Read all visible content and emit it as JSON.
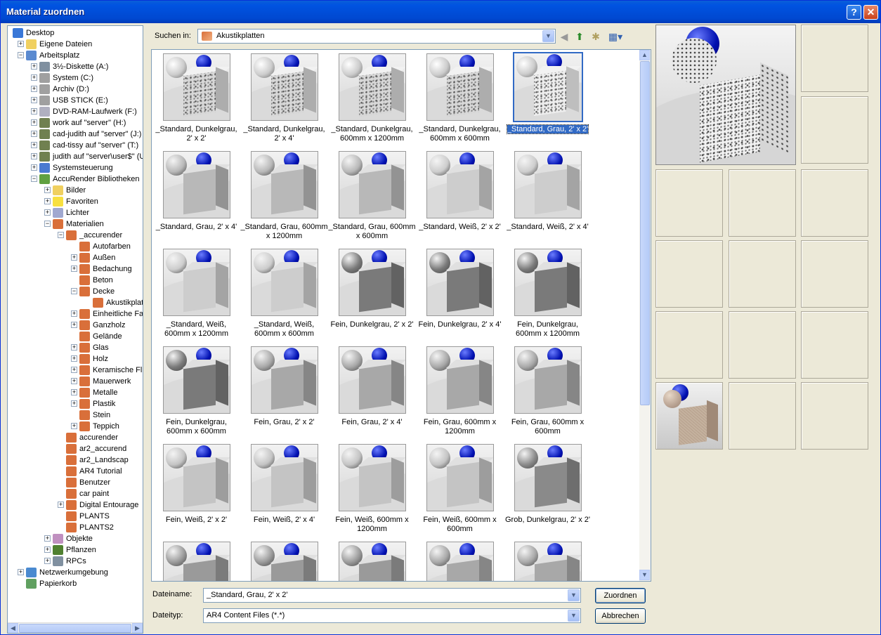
{
  "window": {
    "title": "Material zuordnen",
    "help_glyph": "?",
    "close_glyph": "✕"
  },
  "tree": [
    {
      "label": "Desktop",
      "depth": 0,
      "exp": "",
      "icon": "desktop-icon",
      "color": "#3a78d8"
    },
    {
      "label": "Eigene Dateien",
      "depth": 1,
      "exp": "+",
      "icon": "folder-icon",
      "color": "#f0d060"
    },
    {
      "label": "Arbeitsplatz",
      "depth": 1,
      "exp": "−",
      "icon": "computer-icon",
      "color": "#5a8ad0"
    },
    {
      "label": "3½-Diskette (A:)",
      "depth": 2,
      "exp": "+",
      "icon": "floppy-icon",
      "color": "#8090a0"
    },
    {
      "label": "System (C:)",
      "depth": 2,
      "exp": "+",
      "icon": "drive-icon",
      "color": "#a0a0a0"
    },
    {
      "label": "Archiv (D:)",
      "depth": 2,
      "exp": "+",
      "icon": "drive-icon",
      "color": "#a0a0a0"
    },
    {
      "label": "USB STICK (E:)",
      "depth": 2,
      "exp": "+",
      "icon": "drive-icon",
      "color": "#a0a0a0"
    },
    {
      "label": "DVD-RAM-Laufwerk (F:)",
      "depth": 2,
      "exp": "+",
      "icon": "dvd-icon",
      "color": "#b0b0c0"
    },
    {
      "label": "work auf \"server\" (H:)",
      "depth": 2,
      "exp": "+",
      "icon": "network-drive-icon",
      "color": "#708050"
    },
    {
      "label": "cad-judith auf \"server\" (J:)",
      "depth": 2,
      "exp": "+",
      "icon": "network-drive-icon",
      "color": "#708050"
    },
    {
      "label": "cad-tissy auf \"server\" (T:)",
      "depth": 2,
      "exp": "+",
      "icon": "network-drive-icon",
      "color": "#708050"
    },
    {
      "label": "judith auf \"server\\user$\" (U",
      "depth": 2,
      "exp": "+",
      "icon": "network-drive-icon",
      "color": "#708050"
    },
    {
      "label": "Systemsteuerung",
      "depth": 2,
      "exp": "+",
      "icon": "control-panel-icon",
      "color": "#4a7ad0"
    },
    {
      "label": "AccuRender Bibliotheken",
      "depth": 2,
      "exp": "−",
      "icon": "accurender-icon",
      "color": "#60a040"
    },
    {
      "label": "Bilder",
      "depth": 3,
      "exp": "+",
      "icon": "folder-icon",
      "color": "#f0d060"
    },
    {
      "label": "Favoriten",
      "depth": 3,
      "exp": "+",
      "icon": "star-icon",
      "color": "#f8e040"
    },
    {
      "label": "Lichter",
      "depth": 3,
      "exp": "+",
      "icon": "light-icon",
      "color": "#a0a8d0"
    },
    {
      "label": "Materialien",
      "depth": 3,
      "exp": "−",
      "icon": "material-icon",
      "color": "#d96f3a"
    },
    {
      "label": "_accurender",
      "depth": 4,
      "exp": "−",
      "icon": "material-icon",
      "color": "#d96f3a"
    },
    {
      "label": "Autofarben",
      "depth": 5,
      "exp": "",
      "icon": "material-icon",
      "color": "#d96f3a"
    },
    {
      "label": "Außen",
      "depth": 5,
      "exp": "+",
      "icon": "material-icon",
      "color": "#d96f3a"
    },
    {
      "label": "Bedachung",
      "depth": 5,
      "exp": "+",
      "icon": "material-icon",
      "color": "#d96f3a"
    },
    {
      "label": "Beton",
      "depth": 5,
      "exp": "",
      "icon": "material-icon",
      "color": "#d96f3a"
    },
    {
      "label": "Decke",
      "depth": 5,
      "exp": "−",
      "icon": "material-icon",
      "color": "#d96f3a"
    },
    {
      "label": "Akustikplat",
      "depth": 6,
      "exp": "",
      "icon": "material-icon",
      "color": "#d96f3a"
    },
    {
      "label": "Einheitliche Far",
      "depth": 5,
      "exp": "+",
      "icon": "material-icon",
      "color": "#d96f3a"
    },
    {
      "label": "Ganzholz",
      "depth": 5,
      "exp": "+",
      "icon": "material-icon",
      "color": "#d96f3a"
    },
    {
      "label": "Gelände",
      "depth": 5,
      "exp": "",
      "icon": "material-icon",
      "color": "#d96f3a"
    },
    {
      "label": "Glas",
      "depth": 5,
      "exp": "+",
      "icon": "material-icon",
      "color": "#d96f3a"
    },
    {
      "label": "Holz",
      "depth": 5,
      "exp": "+",
      "icon": "material-icon",
      "color": "#d96f3a"
    },
    {
      "label": "Keramische Flie",
      "depth": 5,
      "exp": "+",
      "icon": "material-icon",
      "color": "#d96f3a"
    },
    {
      "label": "Mauerwerk",
      "depth": 5,
      "exp": "+",
      "icon": "material-icon",
      "color": "#d96f3a"
    },
    {
      "label": "Metalle",
      "depth": 5,
      "exp": "+",
      "icon": "material-icon",
      "color": "#d96f3a"
    },
    {
      "label": "Plastik",
      "depth": 5,
      "exp": "+",
      "icon": "material-icon",
      "color": "#d96f3a"
    },
    {
      "label": "Stein",
      "depth": 5,
      "exp": "",
      "icon": "material-icon",
      "color": "#d96f3a"
    },
    {
      "label": "Teppich",
      "depth": 5,
      "exp": "+",
      "icon": "material-icon",
      "color": "#d96f3a"
    },
    {
      "label": "accurender",
      "depth": 4,
      "exp": "",
      "icon": "material-icon",
      "color": "#d96f3a"
    },
    {
      "label": "ar2_accurend",
      "depth": 4,
      "exp": "",
      "icon": "material-icon",
      "color": "#d96f3a"
    },
    {
      "label": "ar2_Landscap",
      "depth": 4,
      "exp": "",
      "icon": "material-icon",
      "color": "#d96f3a"
    },
    {
      "label": "AR4 Tutorial",
      "depth": 4,
      "exp": "",
      "icon": "material-icon",
      "color": "#d96f3a"
    },
    {
      "label": "Benutzer",
      "depth": 4,
      "exp": "",
      "icon": "material-icon",
      "color": "#d96f3a"
    },
    {
      "label": "car paint",
      "depth": 4,
      "exp": "",
      "icon": "material-icon",
      "color": "#d96f3a"
    },
    {
      "label": "Digital Entourage",
      "depth": 4,
      "exp": "+",
      "icon": "material-icon",
      "color": "#d96f3a"
    },
    {
      "label": "PLANTS",
      "depth": 4,
      "exp": "",
      "icon": "material-icon",
      "color": "#d96f3a"
    },
    {
      "label": "PLANTS2",
      "depth": 4,
      "exp": "",
      "icon": "material-icon",
      "color": "#d96f3a"
    },
    {
      "label": "Objekte",
      "depth": 3,
      "exp": "+",
      "icon": "object-icon",
      "color": "#c090c0"
    },
    {
      "label": "Pflanzen",
      "depth": 3,
      "exp": "+",
      "icon": "plant-icon",
      "color": "#508030"
    },
    {
      "label": "RPCs",
      "depth": 3,
      "exp": "+",
      "icon": "rpc-icon",
      "color": "#8090a0"
    },
    {
      "label": "Netzwerkumgebung",
      "depth": 1,
      "exp": "+",
      "icon": "network-icon",
      "color": "#4a8ad0"
    },
    {
      "label": "Papierkorb",
      "depth": 1,
      "exp": "",
      "icon": "recycle-bin-icon",
      "color": "#60a060"
    }
  ],
  "lookin": {
    "label": "Suchen in:",
    "value": "Akustikplatten"
  },
  "toolbar": {
    "back": "◀",
    "up": "⬆",
    "newfolder": "✱",
    "view": "▦▾"
  },
  "items": [
    {
      "label": "_Standard, Dunkelgrau, 2' x 2'",
      "shade": "#d8d8d8",
      "speckle": true
    },
    {
      "label": "_Standard, Dunkelgrau, 2' x 4'",
      "shade": "#d8d8d8",
      "speckle": true
    },
    {
      "label": "_Standard, Dunkelgrau, 600mm x 1200mm",
      "shade": "#d8d8d8",
      "speckle": true
    },
    {
      "label": "_Standard, Dunkelgrau, 600mm x 600mm",
      "shade": "#d8d8d8",
      "speckle": true
    },
    {
      "label": "_Standard, Grau, 2' x 2'",
      "shade": "#eeeeee",
      "speckle": true,
      "selected": true
    },
    {
      "label": "_Standard, Grau, 2' x 4'",
      "shade": "#b8b8b8"
    },
    {
      "label": "_Standard, Grau, 600mm x 1200mm",
      "shade": "#b8b8b8"
    },
    {
      "label": "_Standard, Grau, 600mm x 600mm",
      "shade": "#b8b8b8"
    },
    {
      "label": "_Standard, Weiß, 2' x 2'",
      "shade": "#cdcdcd"
    },
    {
      "label": "_Standard, Weiß, 2' x 4'",
      "shade": "#cdcdcd"
    },
    {
      "label": "_Standard, Weiß, 600mm x 1200mm",
      "shade": "#cdcdcd"
    },
    {
      "label": "_Standard, Weiß, 600mm x 600mm",
      "shade": "#cdcdcd"
    },
    {
      "label": "Fein, Dunkelgrau, 2' x 2'",
      "shade": "#7a7a7a"
    },
    {
      "label": "Fein, Dunkelgrau, 2' x 4'",
      "shade": "#7a7a7a"
    },
    {
      "label": "Fein, Dunkelgrau, 600mm x 1200mm",
      "shade": "#7a7a7a"
    },
    {
      "label": "Fein, Dunkelgrau, 600mm x 600mm",
      "shade": "#7a7a7a"
    },
    {
      "label": "Fein, Grau, 2' x 2'",
      "shade": "#a8a8a8"
    },
    {
      "label": "Fein, Grau, 2' x 4'",
      "shade": "#a8a8a8"
    },
    {
      "label": "Fein, Grau, 600mm x 1200mm",
      "shade": "#a8a8a8"
    },
    {
      "label": "Fein, Grau, 600mm x 600mm",
      "shade": "#a8a8a8"
    },
    {
      "label": "Fein, Weiß, 2' x 2'",
      "shade": "#c4c4c4"
    },
    {
      "label": "Fein, Weiß, 2' x 4'",
      "shade": "#c4c4c4"
    },
    {
      "label": "Fein, Weiß, 600mm x 1200mm",
      "shade": "#c4c4c4"
    },
    {
      "label": "Fein, Weiß, 600mm x 600mm",
      "shade": "#c4c4c4"
    },
    {
      "label": "Grob, Dunkelgrau, 2' x 2'",
      "shade": "#8a8a8a"
    },
    {
      "label": "",
      "shade": "#9a9a9a"
    },
    {
      "label": "",
      "shade": "#9a9a9a"
    },
    {
      "label": "",
      "shade": "#9a9a9a"
    },
    {
      "label": "",
      "shade": "#a8a8a8"
    },
    {
      "label": "",
      "shade": "#a8a8a8"
    }
  ],
  "filename": {
    "label": "Dateiname:",
    "value": "_Standard, Grau, 2' x 2'"
  },
  "filetype": {
    "label": "Dateityp:",
    "value": "AR4 Content Files (*.*)"
  },
  "buttons": {
    "assign": "Zuordnen",
    "cancel": "Abbrechen"
  }
}
